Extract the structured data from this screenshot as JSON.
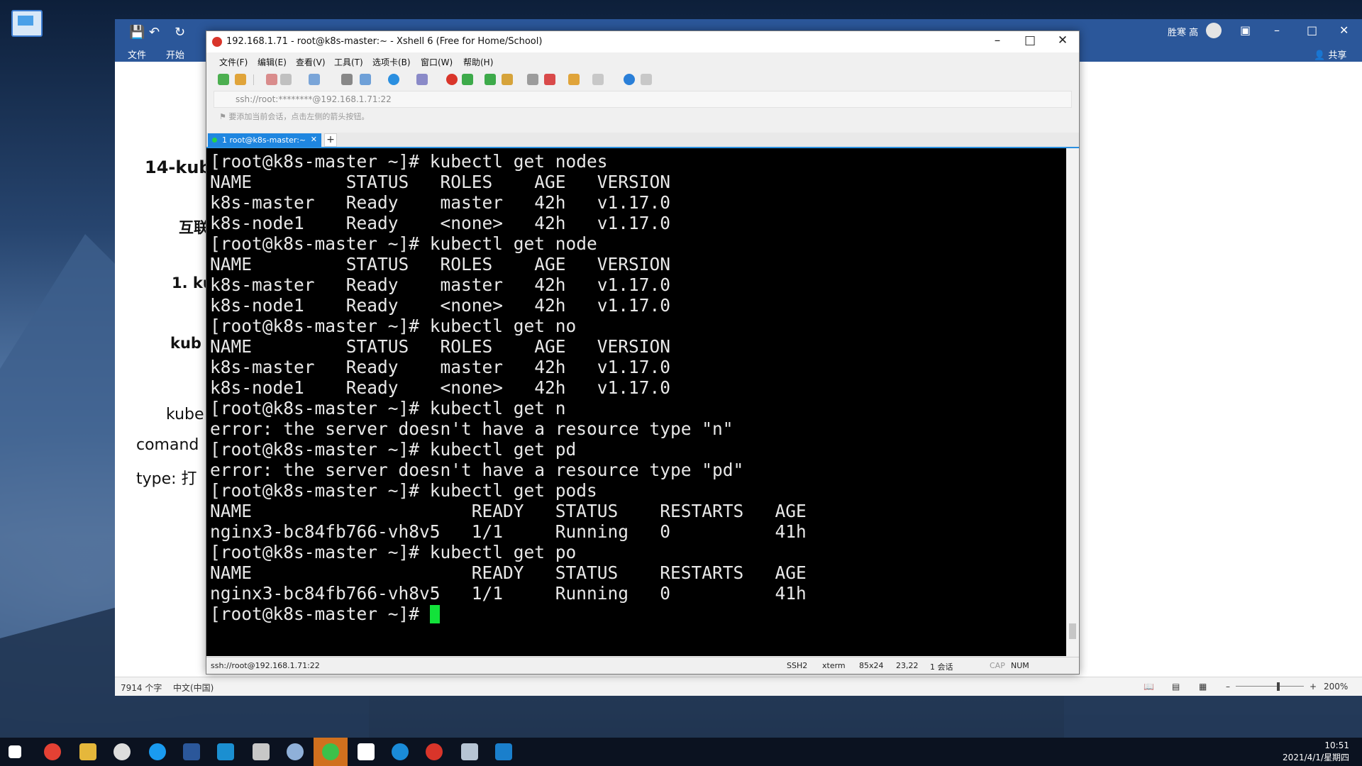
{
  "desktop": {
    "wallpaper": "mountain-landscape"
  },
  "word": {
    "menu": {
      "file": "文件",
      "start": "开始"
    },
    "user": "胜寒 高",
    "share": "共享",
    "doc": {
      "heading": "14-kub",
      "line2": "互联",
      "line3": "1. ku",
      "line4": "kub",
      "line5": "kube",
      "line6": "comand",
      "line7": "type:   打"
    },
    "status": {
      "word_count": "7914 个字",
      "language": "中文(中国)",
      "zoom": "200%"
    }
  },
  "xshell": {
    "title": "192.168.1.71 - root@k8s-master:~ - Xshell 6 (Free for Home/School)",
    "menu": [
      "文件(F)",
      "编辑(E)",
      "查看(V)",
      "工具(T)",
      "选项卡(B)",
      "窗口(W)",
      "帮助(H)"
    ],
    "address": "ssh://root:********@192.168.1.71:22",
    "hint": "要添加当前会话，点击左侧的箭头按钮。",
    "tab_label": "1 root@k8s-master:~",
    "terminal_lines": [
      "[root@k8s-master ~]# kubectl get nodes",
      "NAME         STATUS   ROLES    AGE   VERSION",
      "k8s-master   Ready    master   42h   v1.17.0",
      "k8s-node1    Ready    <none>   42h   v1.17.0",
      "[root@k8s-master ~]# kubectl get node",
      "NAME         STATUS   ROLES    AGE   VERSION",
      "k8s-master   Ready    master   42h   v1.17.0",
      "k8s-node1    Ready    <none>   42h   v1.17.0",
      "[root@k8s-master ~]# kubectl get no",
      "NAME         STATUS   ROLES    AGE   VERSION",
      "k8s-master   Ready    master   42h   v1.17.0",
      "k8s-node1    Ready    <none>   42h   v1.17.0",
      "[root@k8s-master ~]# kubectl get n",
      "error: the server doesn't have a resource type \"n\"",
      "[root@k8s-master ~]# kubectl get pd",
      "error: the server doesn't have a resource type \"pd\"",
      "[root@k8s-master ~]# kubectl get pods",
      "NAME                     READY   STATUS    RESTARTS   AGE",
      "nginx3-bc84fb766-vh8v5   1/1     Running   0          41h",
      "[root@k8s-master ~]# kubectl get po",
      "NAME                     READY   STATUS    RESTARTS   AGE",
      "nginx3-bc84fb766-vh8v5   1/1     Running   0          41h"
    ],
    "prompt": "[root@k8s-master ~]# ",
    "status": {
      "connection": "ssh://root@192.168.1.71:22",
      "protocol": "SSH2",
      "term": "xterm",
      "size": "85x24",
      "cursor_pos": "23,22",
      "sessions": "1 会话",
      "cap": "CAP",
      "num": "NUM"
    }
  },
  "taskbar": {
    "time": "10:51",
    "date": "2021/4/1/星期四"
  }
}
